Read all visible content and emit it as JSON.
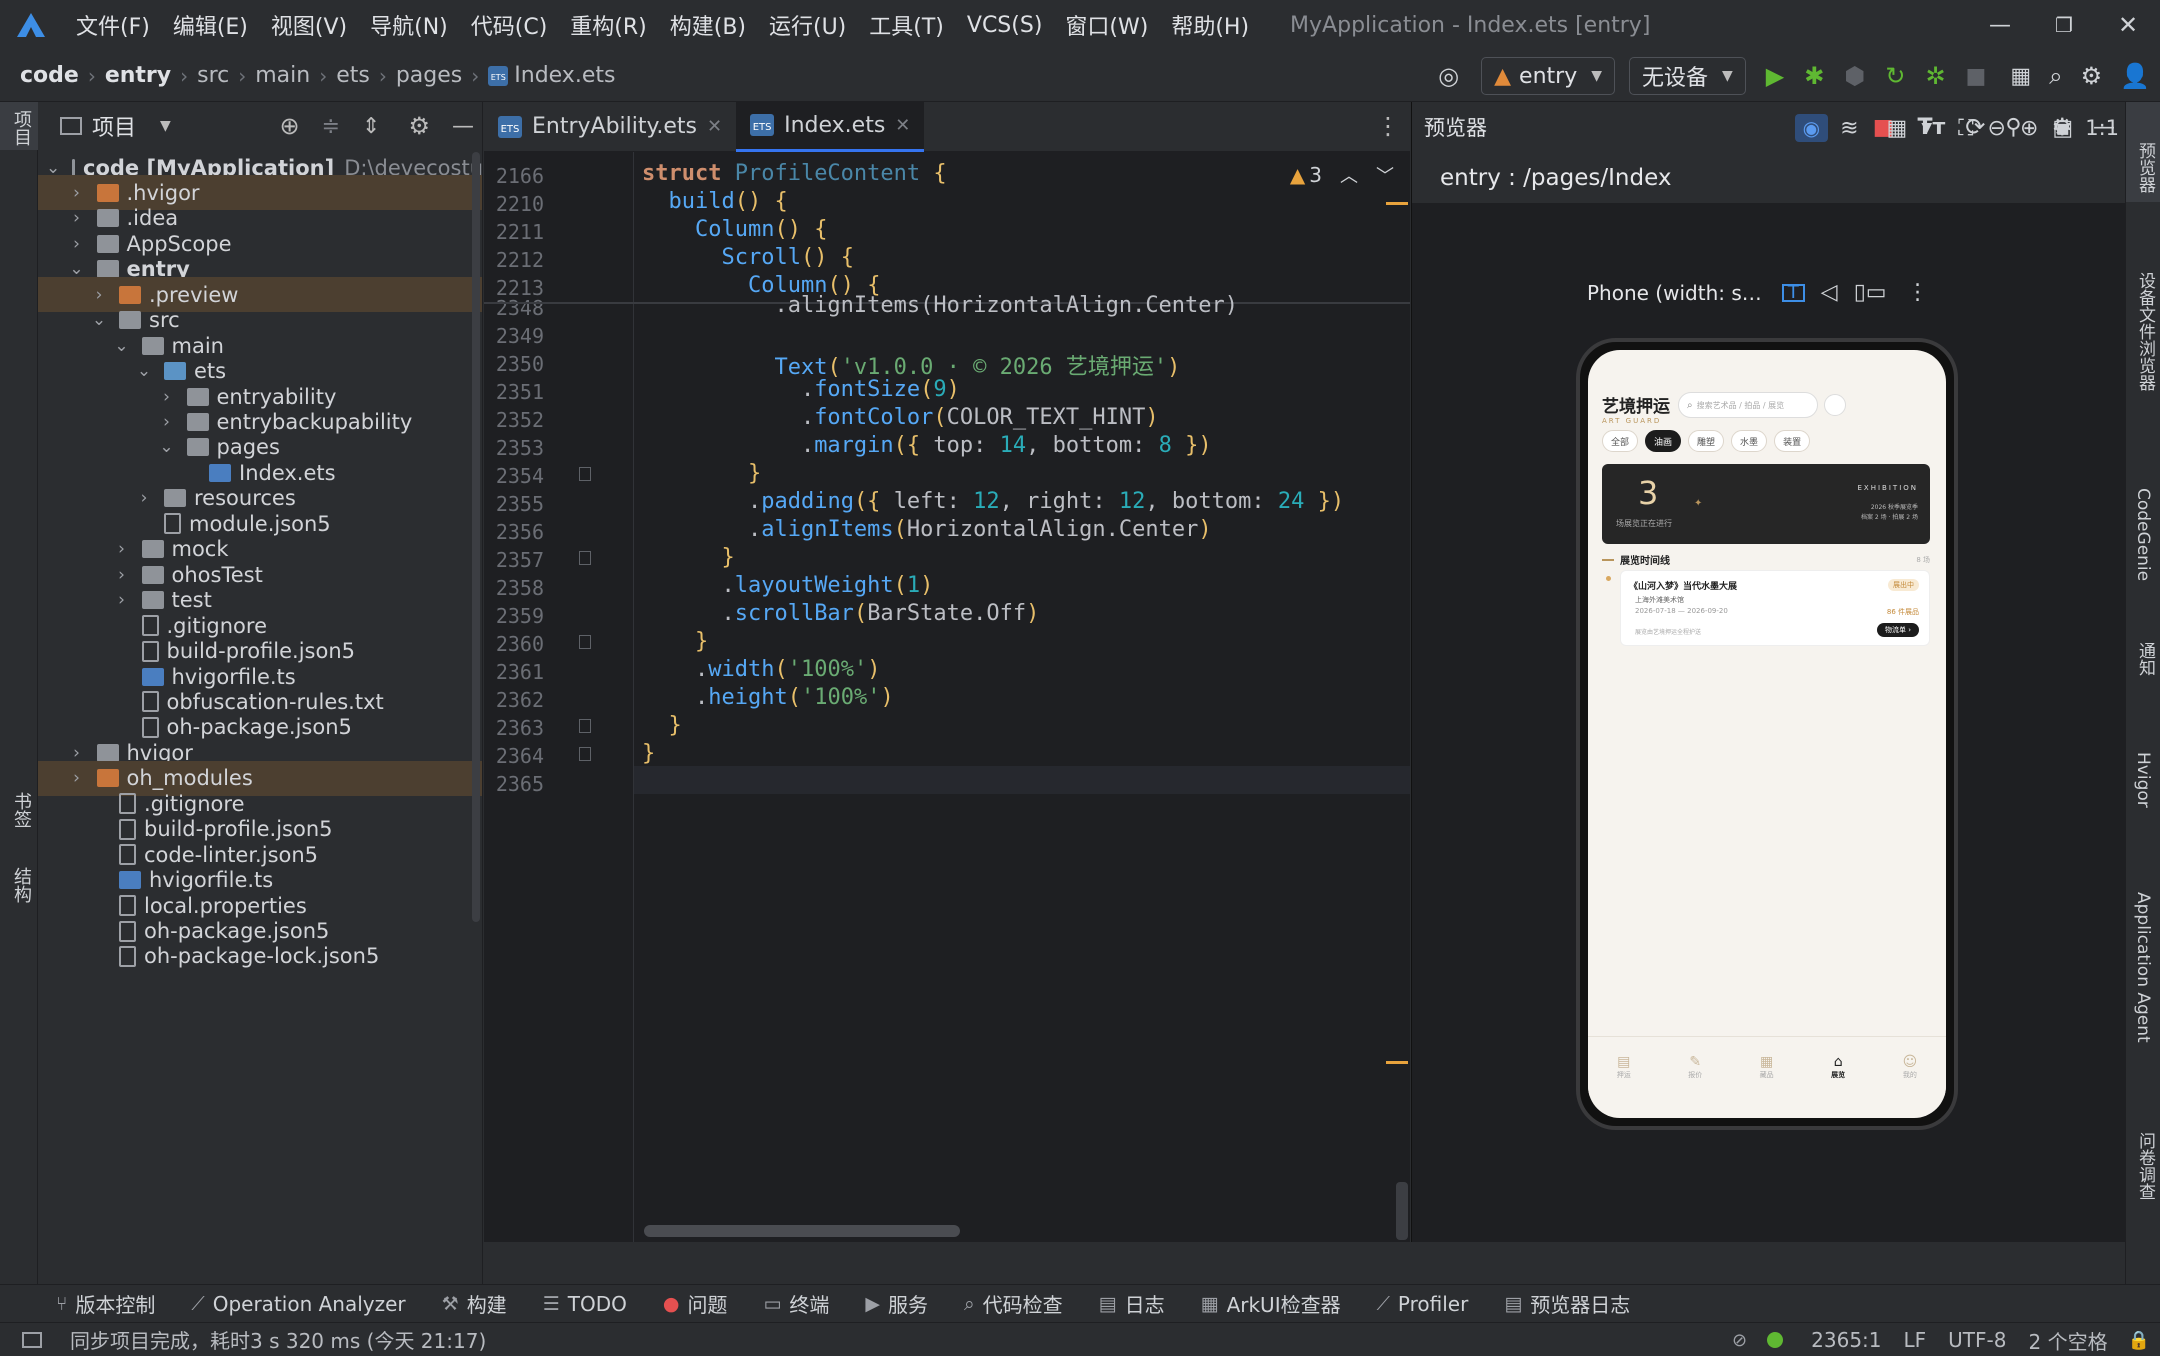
{
  "window": {
    "menu": [
      "文件(F)",
      "编辑(E)",
      "视图(V)",
      "导航(N)",
      "代码(C)",
      "重构(R)",
      "构建(B)",
      "运行(U)",
      "工具(T)",
      "VCS(S)",
      "窗口(W)",
      "帮助(H)"
    ],
    "title": "MyApplication - Index.ets [entry]"
  },
  "breadcrumb": [
    "code",
    "entry",
    "src",
    "main",
    "ets",
    "pages",
    "Index.ets"
  ],
  "run_config": "entry",
  "device": "无设备",
  "left_stripe": {
    "project": "项目",
    "bookmarks": "书签",
    "structure": "结构"
  },
  "project_panel": {
    "title": "项目",
    "tree": [
      {
        "label": "code [MyApplication]",
        "path": "D:\\devecostu",
        "depth": 0,
        "kind": "folder",
        "open": true
      },
      {
        "label": ".hvigor",
        "depth": 1,
        "kind": "folder-o",
        "open": false,
        "hl": true
      },
      {
        "label": ".idea",
        "depth": 1,
        "kind": "folder",
        "open": false
      },
      {
        "label": "AppScope",
        "depth": 1,
        "kind": "folder",
        "open": false
      },
      {
        "label": "entry",
        "depth": 1,
        "kind": "folder",
        "open": true
      },
      {
        "label": ".preview",
        "depth": 2,
        "kind": "folder-o",
        "open": false,
        "hl": true
      },
      {
        "label": "src",
        "depth": 2,
        "kind": "folder",
        "open": true
      },
      {
        "label": "main",
        "depth": 3,
        "kind": "folder",
        "open": true
      },
      {
        "label": "ets",
        "depth": 4,
        "kind": "folder-b",
        "open": true
      },
      {
        "label": "entryability",
        "depth": 5,
        "kind": "folder",
        "open": false
      },
      {
        "label": "entrybackupability",
        "depth": 5,
        "kind": "folder",
        "open": false
      },
      {
        "label": "pages",
        "depth": 5,
        "kind": "folder",
        "open": true
      },
      {
        "label": "Index.ets",
        "depth": 6,
        "kind": "ts",
        "open": null
      },
      {
        "label": "resources",
        "depth": 4,
        "kind": "folder",
        "open": false
      },
      {
        "label": "module.json5",
        "depth": 4,
        "kind": "file",
        "open": null
      },
      {
        "label": "mock",
        "depth": 3,
        "kind": "folder",
        "open": false
      },
      {
        "label": "ohosTest",
        "depth": 3,
        "kind": "folder",
        "open": false
      },
      {
        "label": "test",
        "depth": 3,
        "kind": "folder",
        "open": false
      },
      {
        "label": ".gitignore",
        "depth": 3,
        "kind": "file",
        "open": null
      },
      {
        "label": "build-profile.json5",
        "depth": 3,
        "kind": "file",
        "open": null
      },
      {
        "label": "hvigorfile.ts",
        "depth": 3,
        "kind": "ts",
        "open": null
      },
      {
        "label": "obfuscation-rules.txt",
        "depth": 3,
        "kind": "file",
        "open": null
      },
      {
        "label": "oh-package.json5",
        "depth": 3,
        "kind": "file",
        "open": null
      },
      {
        "label": "hvigor",
        "depth": 1,
        "kind": "folder",
        "open": false
      },
      {
        "label": "oh_modules",
        "depth": 1,
        "kind": "folder-o",
        "open": false,
        "hl": true
      },
      {
        "label": ".gitignore",
        "depth": 2,
        "kind": "file",
        "open": null
      },
      {
        "label": "build-profile.json5",
        "depth": 2,
        "kind": "file",
        "open": null
      },
      {
        "label": "code-linter.json5",
        "depth": 2,
        "kind": "file",
        "open": null
      },
      {
        "label": "hvigorfile.ts",
        "depth": 2,
        "kind": "ts",
        "open": null
      },
      {
        "label": "local.properties",
        "depth": 2,
        "kind": "file",
        "open": null
      },
      {
        "label": "oh-package.json5",
        "depth": 2,
        "kind": "file",
        "open": null
      },
      {
        "label": "oh-package-lock.json5",
        "depth": 2,
        "kind": "file",
        "open": null
      }
    ]
  },
  "editor": {
    "tabs": [
      {
        "label": "EntryAbility.ets",
        "active": false
      },
      {
        "label": "Index.ets",
        "active": true
      }
    ],
    "warnings": "3",
    "sticky_lines": [
      {
        "ln": "2166",
        "parts": [
          [
            "kw",
            "struct "
          ],
          [
            "cls",
            "ProfileContent "
          ],
          [
            "br",
            "{"
          ]
        ]
      },
      {
        "ln": "2210",
        "parts": [
          [
            "plain",
            "  "
          ],
          [
            "fn",
            "build"
          ],
          [
            "br",
            "() {"
          ]
        ]
      },
      {
        "ln": "2211",
        "parts": [
          [
            "plain",
            "    "
          ],
          [
            "fn",
            "Column"
          ],
          [
            "br",
            "() {"
          ]
        ]
      },
      {
        "ln": "2212",
        "parts": [
          [
            "plain",
            "      "
          ],
          [
            "fn",
            "Scroll"
          ],
          [
            "br",
            "() {"
          ]
        ]
      },
      {
        "ln": "2213",
        "parts": [
          [
            "plain",
            "        "
          ],
          [
            "fn",
            "Column"
          ],
          [
            "br",
            "() {"
          ]
        ]
      }
    ],
    "lines": [
      {
        "ln": "2348",
        "parts": [
          [
            "plain",
            "          .alignItems(HorizontalAlign.Center)"
          ]
        ]
      },
      {
        "ln": "2349",
        "parts": []
      },
      {
        "ln": "2350",
        "parts": [
          [
            "plain",
            "          "
          ],
          [
            "fn",
            "Text"
          ],
          [
            "br",
            "("
          ],
          [
            "str",
            "'v1.0.0 · © 2026 艺境押运'"
          ],
          [
            "br",
            ")"
          ]
        ]
      },
      {
        "ln": "2351",
        "parts": [
          [
            "plain",
            "            ."
          ],
          [
            "fn",
            "fontSize"
          ],
          [
            "br",
            "("
          ],
          [
            "num",
            "9"
          ],
          [
            "br",
            ")"
          ]
        ]
      },
      {
        "ln": "2352",
        "parts": [
          [
            "plain",
            "            ."
          ],
          [
            "fn",
            "fontColor"
          ],
          [
            "br",
            "("
          ],
          [
            "plain",
            "COLOR_TEXT_HINT"
          ],
          [
            "br",
            ")"
          ]
        ]
      },
      {
        "ln": "2353",
        "parts": [
          [
            "plain",
            "            ."
          ],
          [
            "fn",
            "margin"
          ],
          [
            "br",
            "({ "
          ],
          [
            "plain",
            "top: "
          ],
          [
            "num",
            "14"
          ],
          [
            "plain",
            ", bottom: "
          ],
          [
            "num",
            "8"
          ],
          [
            "br",
            " })"
          ]
        ]
      },
      {
        "ln": "2354",
        "parts": [
          [
            "plain",
            "        "
          ],
          [
            "br",
            "}"
          ]
        ]
      },
      {
        "ln": "2355",
        "parts": [
          [
            "plain",
            "        ."
          ],
          [
            "fn",
            "padding"
          ],
          [
            "br",
            "({ "
          ],
          [
            "plain",
            "left: "
          ],
          [
            "num",
            "12"
          ],
          [
            "plain",
            ", right: "
          ],
          [
            "num",
            "12"
          ],
          [
            "plain",
            ", bottom: "
          ],
          [
            "num",
            "24"
          ],
          [
            "br",
            " })"
          ]
        ]
      },
      {
        "ln": "2356",
        "parts": [
          [
            "plain",
            "        ."
          ],
          [
            "fn",
            "alignItems"
          ],
          [
            "br",
            "("
          ],
          [
            "plain",
            "HorizontalAlign.Center"
          ],
          [
            "br",
            ")"
          ]
        ]
      },
      {
        "ln": "2357",
        "parts": [
          [
            "plain",
            "      "
          ],
          [
            "br",
            "}"
          ]
        ]
      },
      {
        "ln": "2358",
        "parts": [
          [
            "plain",
            "      ."
          ],
          [
            "fn",
            "layoutWeight"
          ],
          [
            "br",
            "("
          ],
          [
            "num",
            "1"
          ],
          [
            "br",
            ")"
          ]
        ]
      },
      {
        "ln": "2359",
        "parts": [
          [
            "plain",
            "      ."
          ],
          [
            "fn",
            "scrollBar"
          ],
          [
            "br",
            "("
          ],
          [
            "plain",
            "BarState.Off"
          ],
          [
            "br",
            ")"
          ]
        ]
      },
      {
        "ln": "2360",
        "parts": [
          [
            "plain",
            "    "
          ],
          [
            "br",
            "}"
          ]
        ]
      },
      {
        "ln": "2361",
        "parts": [
          [
            "plain",
            "    ."
          ],
          [
            "fn",
            "width"
          ],
          [
            "br",
            "("
          ],
          [
            "str",
            "'100%'"
          ],
          [
            "br",
            ")"
          ]
        ]
      },
      {
        "ln": "2362",
        "parts": [
          [
            "plain",
            "    ."
          ],
          [
            "fn",
            "height"
          ],
          [
            "br",
            "("
          ],
          [
            "str",
            "'100%'"
          ],
          [
            "br",
            ")"
          ]
        ]
      },
      {
        "ln": "2363",
        "parts": [
          [
            "plain",
            "  "
          ],
          [
            "br",
            "}"
          ]
        ]
      },
      {
        "ln": "2364",
        "parts": [
          [
            "br",
            "}"
          ]
        ]
      },
      {
        "ln": "2365",
        "parts": []
      }
    ]
  },
  "previewer": {
    "title": "预览器",
    "route": "entry : /pages/Index",
    "device_label": "Phone (width: s…",
    "zoom_label": "1:1"
  },
  "phone_app": {
    "brand": "艺境押运",
    "brand_en": "ART GUARD",
    "search_placeholder": "搜索艺术品 / 拍品 / 展览",
    "chips": [
      "全部",
      "油画",
      "雕塑",
      "水墨",
      "装置"
    ],
    "hero": {
      "count": "3",
      "count_label": "场展览正在进行",
      "tag": "EXHIBITION",
      "line1": "2026 秋季展览季",
      "line2": "档案 2 场 · 拍展 2 场"
    },
    "timeline_title": "展览时间线",
    "timeline_count": "8 场",
    "card": {
      "title": "《山河入梦》当代水墨大展",
      "status": "展出中",
      "venue": "上海外滩美术馆",
      "dates": "2026-07-18 — 2026-09-20",
      "items": "86 件展品",
      "note": "展览由艺境押运全程护送",
      "button": "物流单 ›"
    },
    "tabs": [
      "押运",
      "报价",
      "藏品",
      "展览",
      "我的"
    ]
  },
  "right_stripe": [
    "预览器",
    "设备文件浏览器",
    "CodeGenie",
    "通知",
    "Hvigor",
    "Application Agent",
    "问卷调查"
  ],
  "bottom_tools": [
    "版本控制",
    "Operation Analyzer",
    "构建",
    "TODO",
    "问题",
    "终端",
    "服务",
    "代码检查",
    "日志",
    "ArkUI检查器",
    "Profiler",
    "预览器日志"
  ],
  "status": {
    "message": "同步项目完成，耗时3 s 320 ms (今天 21:17)",
    "position": "2365:1",
    "line_sep": "LF",
    "encoding": "UTF-8",
    "indent": "2 个空格"
  },
  "colors": {
    "accent": "#3574f0",
    "run_green": "#5fb832",
    "stop_red": "#e55050",
    "warning": "#e8a33d"
  }
}
